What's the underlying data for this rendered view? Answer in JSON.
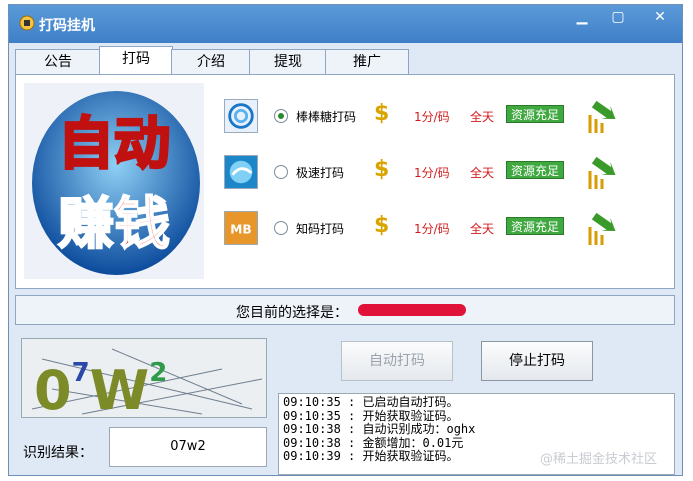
{
  "window": {
    "title": "打码挂机"
  },
  "tabs": [
    {
      "label": "公告"
    },
    {
      "label": "打码"
    },
    {
      "label": "介绍"
    },
    {
      "label": "提现"
    },
    {
      "label": "推广"
    }
  ],
  "logo": {
    "line1": "自动",
    "line2": "赚钱"
  },
  "options": [
    {
      "label": "棒棒糖打码",
      "dollar": "$",
      "price": "1分/码",
      "time": "全天",
      "status": "资源充足",
      "checked": true,
      "icon": "swirl-icon"
    },
    {
      "label": "极速打码",
      "dollar": "$",
      "price": "1分/码",
      "time": "全天",
      "status": "资源充足",
      "checked": false,
      "icon": "globe-icon"
    },
    {
      "label": "知码打码",
      "dollar": "$",
      "price": "1分/码",
      "time": "全天",
      "status": "资源充足",
      "checked": false,
      "icon": "mb-icon"
    }
  ],
  "selection": {
    "label": "您目前的选择是："
  },
  "captcha": {
    "text": "0⁷W²"
  },
  "result": {
    "label": "识别结果：",
    "value": "07w2"
  },
  "buttons": {
    "auto": "自动打码",
    "stop": "停止打码"
  },
  "log": [
    "09:10:35 : 已启动自动打码。",
    "09:10:35 : 开始获取验证码。",
    "09:10:38 : 自动识别成功：oghx",
    "09:10:38 : 金额增加：0.01元",
    "09:10:39 : 开始获取验证码。"
  ],
  "watermark": "@稀土掘金技术社区",
  "colors": {
    "accent": "#3f7fc7",
    "status_green": "#3fa83f",
    "price_red": "#d21b1b",
    "dollar_gold": "#d9a400"
  }
}
